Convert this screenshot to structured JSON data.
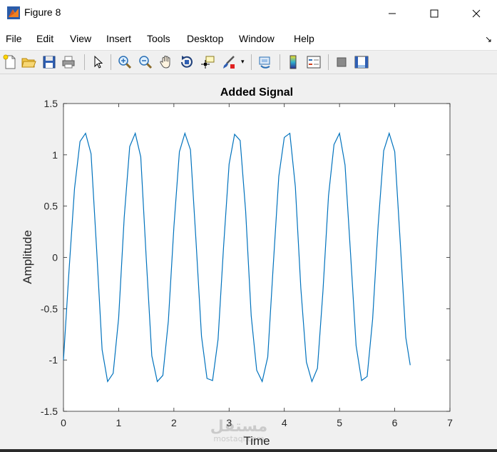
{
  "window": {
    "title": "Figure 8"
  },
  "menu": [
    "File",
    "Edit",
    "View",
    "Insert",
    "Tools",
    "Desktop",
    "Window",
    "Help"
  ],
  "toolbar": {
    "icons": [
      "new-figure-icon",
      "open-file-icon",
      "save-icon",
      "print-icon",
      "select-arrow-icon",
      "zoom-in-icon",
      "zoom-out-icon",
      "pan-hand-icon",
      "rotate-3d-icon",
      "data-cursor-icon",
      "brush-icon",
      "link-plot-icon",
      "insert-colorbar-icon",
      "insert-legend-icon",
      "hide-plot-tools-icon",
      "show-plot-tools-icon"
    ]
  },
  "colors": {
    "line": "#0072BD",
    "axes_bg": "#ffffff",
    "figure_bg": "#f0f0f0"
  },
  "chart_data": {
    "type": "line",
    "title": "Added Signal",
    "xlabel": "Time",
    "ylabel": "Amplitude",
    "xlim": [
      0,
      7
    ],
    "ylim": [
      -1.5,
      1.5
    ],
    "xticks": [
      "0",
      "1",
      "2",
      "3",
      "4",
      "5",
      "6",
      "7"
    ],
    "yticks": [
      "-1.5",
      "-1",
      "-0.5",
      "0",
      "0.5",
      "1",
      "1.5"
    ],
    "grid": false,
    "series": [
      {
        "x": [
          0,
          0.1,
          0.2,
          0.3,
          0.4,
          0.5,
          0.6,
          0.7,
          0.8,
          0.9,
          1.0,
          1.1,
          1.2,
          1.3,
          1.4,
          1.5,
          1.6,
          1.7,
          1.8,
          1.9,
          2.0,
          2.1,
          2.2,
          2.3,
          2.4,
          2.5,
          2.6,
          2.7,
          2.8,
          2.9,
          3.0,
          3.1,
          3.2,
          3.3,
          3.4,
          3.5,
          3.6,
          3.7,
          3.8,
          3.9,
          4.0,
          4.1,
          4.2,
          4.3,
          4.4,
          4.5,
          4.6,
          4.7,
          4.8,
          4.9,
          5.0,
          5.1,
          5.2,
          5.3,
          5.4,
          5.5,
          5.6,
          5.7,
          5.8,
          5.9,
          6.0,
          6.1,
          6.2,
          6.28
        ],
        "y": [
          -1.0,
          -0.14,
          0.67,
          1.13,
          1.21,
          1.01,
          0.08,
          -0.9,
          -1.21,
          -1.13,
          -0.59,
          0.39,
          1.08,
          1.21,
          0.98,
          -0.01,
          -0.96,
          -1.21,
          -1.15,
          -0.62,
          0.3,
          1.03,
          1.21,
          1.05,
          0.17,
          -0.77,
          -1.18,
          -1.2,
          -0.8,
          0.1,
          0.91,
          1.2,
          1.14,
          0.45,
          -0.57,
          -1.1,
          -1.21,
          -0.97,
          -0.08,
          0.79,
          1.17,
          1.21,
          0.69,
          -0.3,
          -1.02,
          -1.21,
          -1.08,
          -0.33,
          0.6,
          1.1,
          1.21,
          0.9,
          0.04,
          -0.86,
          -1.2,
          -1.16,
          -0.6,
          0.31,
          1.04,
          1.21,
          1.03,
          0.15,
          -0.78,
          -1.05
        ]
      }
    ]
  },
  "watermark": {
    "text": "مستقل",
    "subtext": "mostaql.com"
  }
}
